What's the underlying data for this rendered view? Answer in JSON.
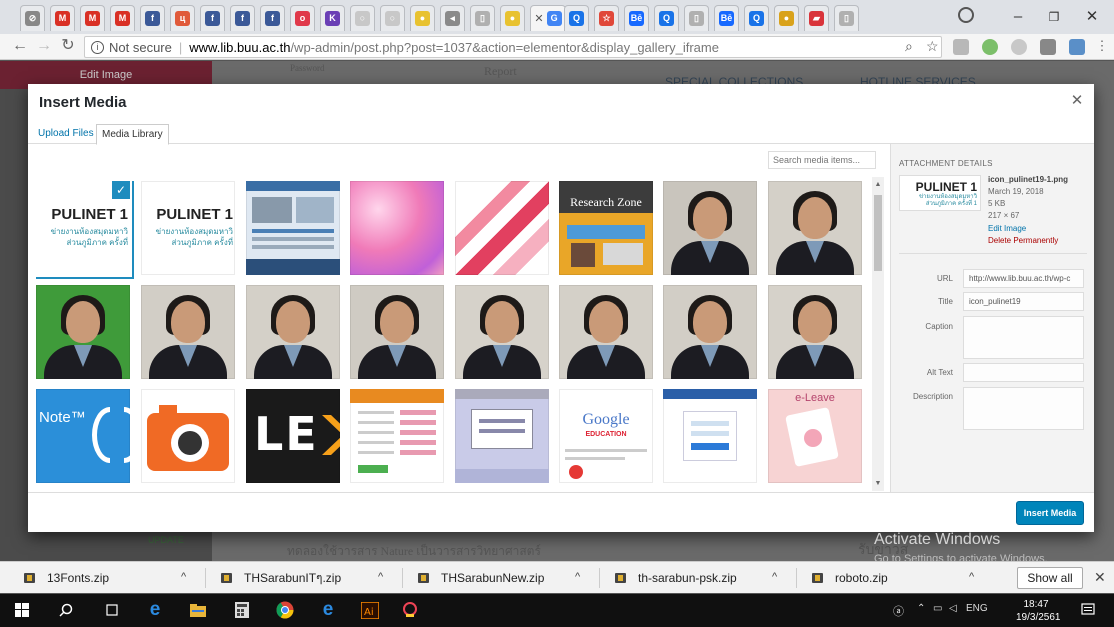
{
  "browser": {
    "tabs": [
      {
        "icon": "chrome-icon",
        "color": "#888888",
        "glyph": "⊘"
      },
      {
        "icon": "gmail-icon",
        "color": "#d93025",
        "glyph": "M"
      },
      {
        "icon": "gmail-icon",
        "color": "#d93025",
        "glyph": "M"
      },
      {
        "icon": "gmail-icon",
        "color": "#d93025",
        "glyph": "M"
      },
      {
        "icon": "facebook-icon",
        "color": "#3b5998",
        "glyph": "f"
      },
      {
        "icon": "app-icon",
        "color": "#e05a3a",
        "glyph": "ц"
      },
      {
        "icon": "facebook-icon",
        "color": "#3b5998",
        "glyph": "f"
      },
      {
        "icon": "facebook-icon",
        "color": "#3b5998",
        "glyph": "f"
      },
      {
        "icon": "facebook-icon",
        "color": "#3b5998",
        "glyph": "f"
      },
      {
        "icon": "o2c-icon",
        "color": "#e0394a",
        "glyph": "o"
      },
      {
        "icon": "k-icon",
        "color": "#6a3fb5",
        "glyph": "K"
      },
      {
        "icon": "blank-icon",
        "color": "#c8c8c8",
        "glyph": "○"
      },
      {
        "icon": "blank-icon",
        "color": "#c8c8c8",
        "glyph": "○"
      },
      {
        "icon": "yellow-icon",
        "color": "#e8c230",
        "glyph": "●"
      },
      {
        "icon": "audio-icon",
        "color": "#8a8a8a",
        "glyph": "◂"
      },
      {
        "icon": "doc-icon",
        "color": "#b0b0b0",
        "glyph": "▯"
      },
      {
        "icon": "yellow-icon",
        "color": "#e8c230",
        "glyph": "●"
      },
      {
        "icon": "google-icon",
        "color": "#4285f4",
        "glyph": "G"
      },
      {
        "icon": "search-tab-icon",
        "color": "#1a73e8",
        "glyph": "Q"
      },
      {
        "icon": "star-icon",
        "color": "#e0483a",
        "glyph": "☆"
      },
      {
        "icon": "behance-icon",
        "color": "#1769ff",
        "glyph": "Bē"
      },
      {
        "icon": "search-tab-icon",
        "color": "#1a73e8",
        "glyph": "Q"
      },
      {
        "icon": "doc-icon",
        "color": "#b0b0b0",
        "glyph": "▯"
      },
      {
        "icon": "behance-icon",
        "color": "#1769ff",
        "glyph": "Bē"
      },
      {
        "icon": "search-tab-icon",
        "color": "#1a73e8",
        "glyph": "Q"
      },
      {
        "icon": "yellow-icon",
        "color": "#d9a21b",
        "glyph": "●"
      },
      {
        "icon": "chart-icon",
        "color": "#d9343b",
        "glyph": "▰"
      },
      {
        "icon": "doc-icon",
        "color": "#b0b0b0",
        "glyph": "▯"
      }
    ],
    "active_tab_index": 17,
    "url_secure_label": "Not secure",
    "url_host": "www.lib.buu.ac.th",
    "url_path": "/wp-admin/post.php?post=1037&action=elementor&display_gallery_iframe"
  },
  "background_page": {
    "edit_image": "Edit Image",
    "password": "Password",
    "report": "Report",
    "special_collections": "SPECIAL COLLECTIONS",
    "hotline_services": "HOTLINE SERVICES",
    "update": "UPDATE",
    "thai_text": "ทดลองใช้วารสาร Nature เป็นวารสารวิทยาศาสตร์",
    "thai_right": "รับข่าวส"
  },
  "modal": {
    "title": "Insert Media",
    "tabs": [
      "Upload Files",
      "Media Library"
    ],
    "active_tab": "Media Library",
    "search_placeholder": "Search media items...",
    "insert_button": "Insert Media",
    "grid": [
      {
        "kind": "pulinet",
        "bg": "#ffffff",
        "title": "PULINET 1",
        "sub1": "ข่ายงานห้องสมุดมหาวิ",
        "sub2": "ส่วนภูมิภาค ครั้งที่",
        "selected": true
      },
      {
        "kind": "pulinet",
        "bg": "#ffffff",
        "title": "PULINET 1",
        "sub1": "ข่ายงานห้องสมุดมหาวิ",
        "sub2": "ส่วนภูมิภาค ครั้งที่",
        "selected": false
      },
      {
        "kind": "screenshot",
        "bg": "#dfe8f2"
      },
      {
        "kind": "gradient",
        "bg": "#f0a0c8"
      },
      {
        "kind": "triangles",
        "bg": "#f4f4f4"
      },
      {
        "kind": "research",
        "bg": "#e9a628",
        "label": "Research Zone"
      },
      {
        "kind": "portrait",
        "bg": "#c9c5bd"
      },
      {
        "kind": "portrait",
        "bg": "#d4d0c8"
      },
      {
        "kind": "portrait",
        "bg": "#3f9b3a"
      },
      {
        "kind": "portrait",
        "bg": "#d2cec6"
      },
      {
        "kind": "portrait",
        "bg": "#d4d0c8"
      },
      {
        "kind": "portrait",
        "bg": "#cfcbc3"
      },
      {
        "kind": "portrait",
        "bg": "#d6d2ca"
      },
      {
        "kind": "portrait",
        "bg": "#d4d0c8"
      },
      {
        "kind": "portrait",
        "bg": "#d2cec6"
      },
      {
        "kind": "portrait",
        "bg": "#d6d2ca"
      },
      {
        "kind": "note",
        "bg": "#2b8fd9",
        "label": "Note™"
      },
      {
        "kind": "camera",
        "bg": "#ffffff"
      },
      {
        "kind": "lex",
        "bg": "#1a1a1a",
        "label": "LE"
      },
      {
        "kind": "form",
        "bg": "#ffffff"
      },
      {
        "kind": "webpage",
        "bg": "#c9cbe8"
      },
      {
        "kind": "google",
        "bg": "#ffffff",
        "label": "Google",
        "sub": "EDUCATION"
      },
      {
        "kind": "login",
        "bg": "#ffffff"
      },
      {
        "kind": "eleave",
        "bg": "#f7d3d3",
        "label": "e-Leave"
      }
    ],
    "details": {
      "heading": "ATTACHMENT DETAILS",
      "thumb_title": "PULINET 1",
      "thumb_sub": "ข่ายงานห้องสมุดมหาวิ",
      "thumb_sub2": "ส่วนภูมิภาค ครั้งที่ 1",
      "filename": "icon_pulinet19-1.png",
      "date": "March 19, 2018",
      "size": "5 KB",
      "dimensions": "217 × 67",
      "edit_image": "Edit Image",
      "delete": "Delete Permanently",
      "url_label": "URL",
      "url_value": "http://www.lib.buu.ac.th/wp-c",
      "title_label": "Title",
      "title_value": "icon_pulinet19",
      "caption_label": "Caption",
      "alt_label": "Alt Text",
      "description_label": "Description"
    }
  },
  "watermark": {
    "line1": "Activate Windows",
    "line2": "Go to Settings to activate Windows."
  },
  "downloads": {
    "items": [
      "13Fonts.zip",
      "THSarabunITๆ.zip",
      "THSarabunNew.zip",
      "th-sarabun-psk.zip",
      "roboto.zip"
    ],
    "show_all": "Show all"
  },
  "taskbar": {
    "lang": "ENG",
    "time": "18:47",
    "date": "19/3/2561"
  }
}
